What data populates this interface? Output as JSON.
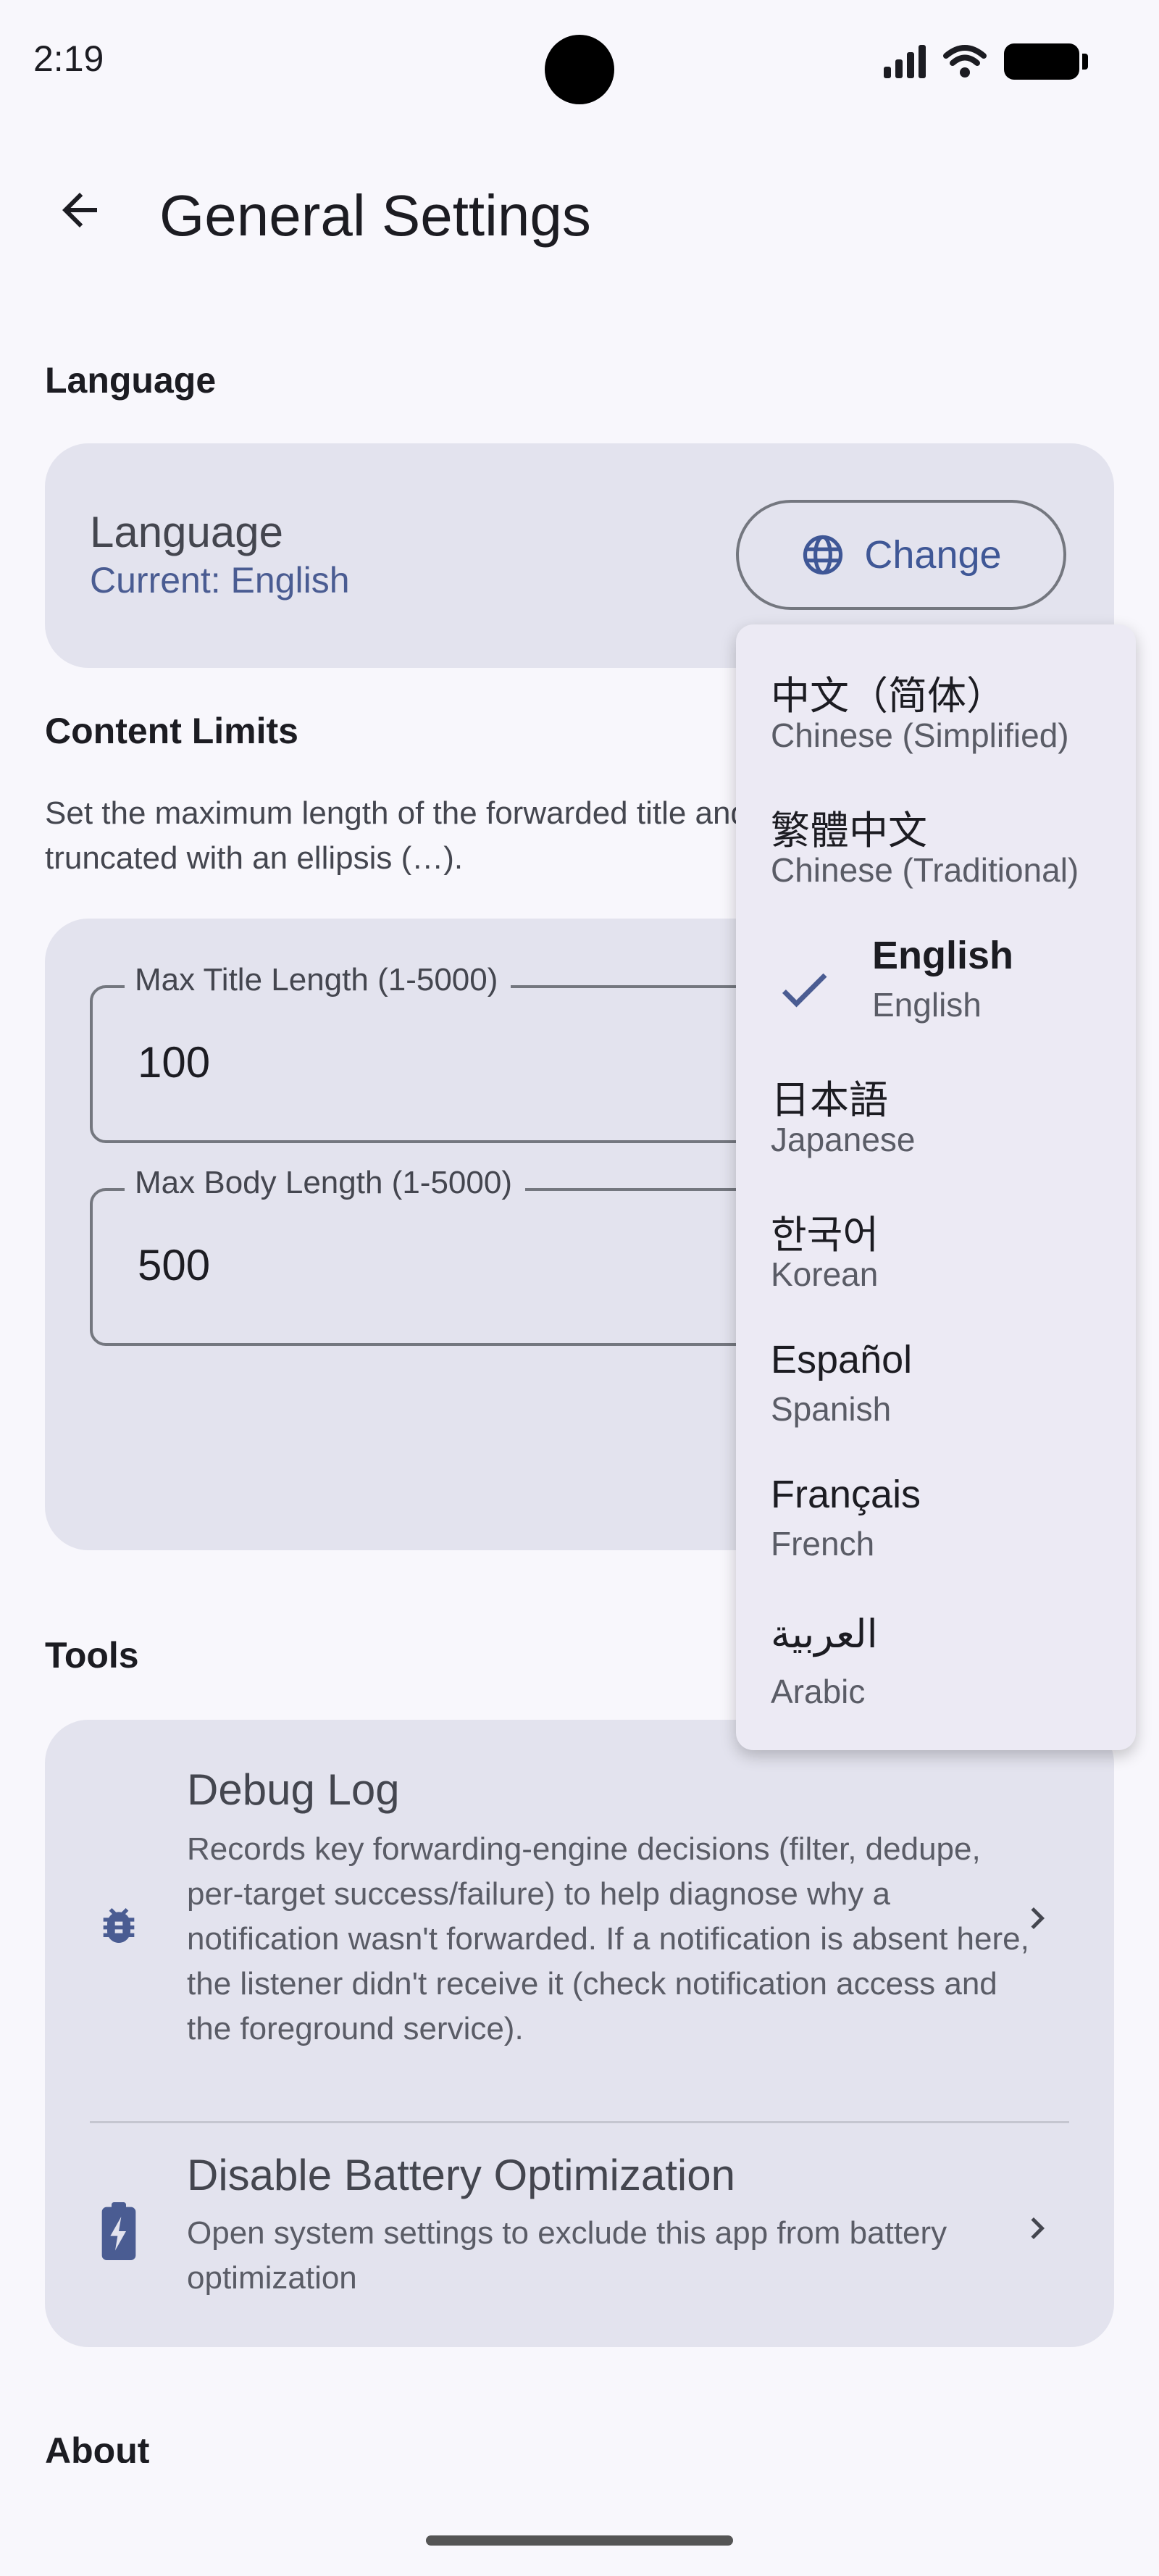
{
  "status_bar": {
    "time": "2:19"
  },
  "header": {
    "title": "General Settings"
  },
  "sections": {
    "language": "Language",
    "content_limits": "Content Limits",
    "tools": "Tools",
    "about": "About"
  },
  "language_card": {
    "title": "Language",
    "current": "Current: English",
    "change_label": "Change"
  },
  "content_limits": {
    "description": "Set the maximum length of the forwarded title and body. Longer text is truncated with an ellipsis (…).",
    "max_title": {
      "label": "Max Title Length (1-5000)",
      "value": "100"
    },
    "max_body": {
      "label": "Max Body Length (1-5000)",
      "value": "500"
    }
  },
  "tools": {
    "debug_log": {
      "title": "Debug Log",
      "description": "Records key forwarding-engine decisions (filter, dedupe, per-target success/failure) to help diagnose why a notification wasn't forwarded. If a notification is absent here, the listener didn't receive it (check notification access and the foreground service)."
    },
    "battery": {
      "title": "Disable Battery Optimization",
      "description": "Open system settings to exclude this app from battery optimization"
    }
  },
  "language_menu": {
    "selected_index": 2,
    "items": [
      {
        "native": "中文（简体）",
        "english": "Chinese (Simplified)"
      },
      {
        "native": "繁體中文",
        "english": "Chinese (Traditional)"
      },
      {
        "native": "English",
        "english": "English"
      },
      {
        "native": "日本語",
        "english": "Japanese"
      },
      {
        "native": "한국어",
        "english": "Korean"
      },
      {
        "native": "Español",
        "english": "Spanish"
      },
      {
        "native": "Français",
        "english": "French"
      },
      {
        "native": "العربية",
        "english": "Arabic"
      }
    ]
  },
  "colors": {
    "accent": "#3f5796",
    "card_background": "#e3e3ee",
    "page_background": "#f8f7fc",
    "menu_background": "#eceaf4"
  }
}
